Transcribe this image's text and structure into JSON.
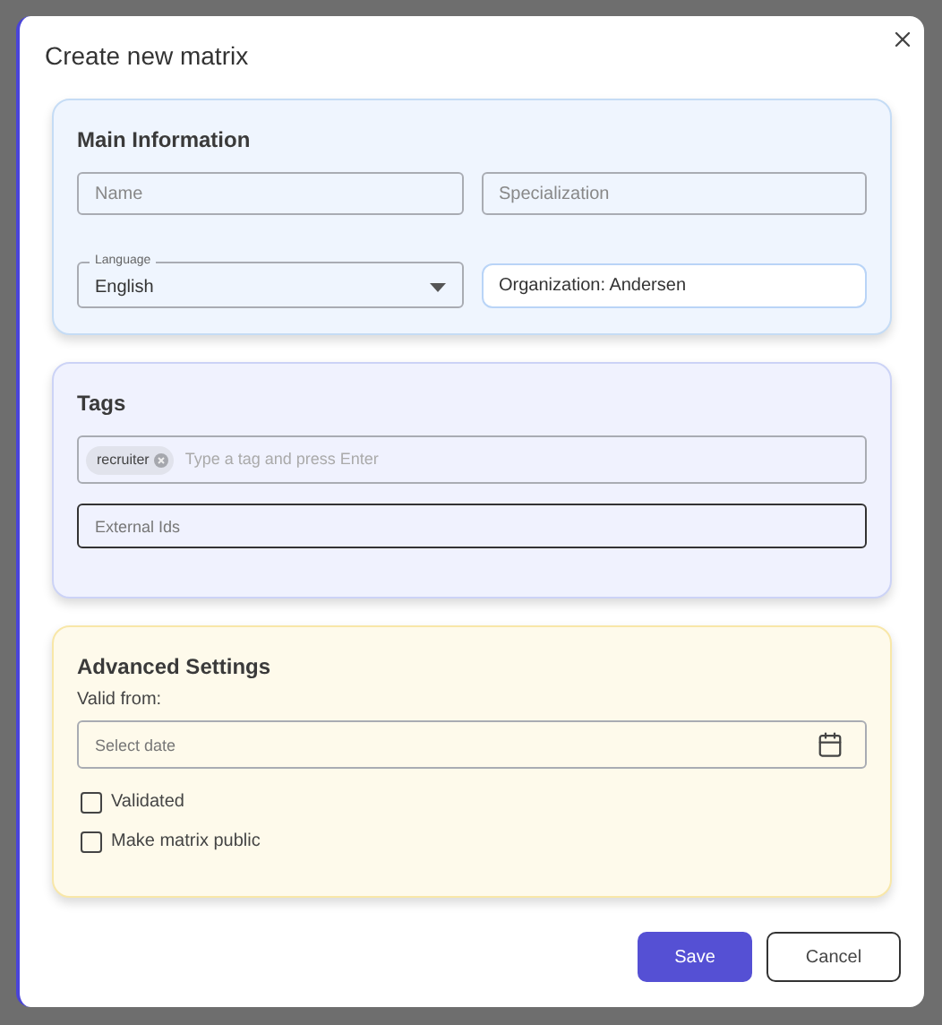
{
  "dialog": {
    "title": "Create new matrix"
  },
  "main_information": {
    "heading": "Main Information",
    "name": {
      "placeholder": "Name"
    },
    "specialization": {
      "placeholder": "Specialization"
    },
    "language": {
      "label": "Language",
      "value": "English"
    },
    "organization": {
      "value": "Organization: Andersen"
    }
  },
  "tags": {
    "heading": "Tags",
    "chips": [
      "recruiter"
    ],
    "tag_input": {
      "placeholder": "Type a tag and press Enter"
    },
    "external_ids": {
      "placeholder": "External Ids",
      "focused": true
    }
  },
  "advanced_settings": {
    "heading": "Advanced Settings",
    "valid_from_label": "Valid from:",
    "date": {
      "placeholder": "Select date"
    },
    "options": [
      {
        "label": "Validated",
        "checked": false
      },
      {
        "label": "Make matrix public",
        "checked": false
      }
    ]
  },
  "buttons": [
    {
      "label": "Save",
      "kind": "primary"
    },
    {
      "label": "Cancel",
      "kind": "secondary"
    }
  ]
}
